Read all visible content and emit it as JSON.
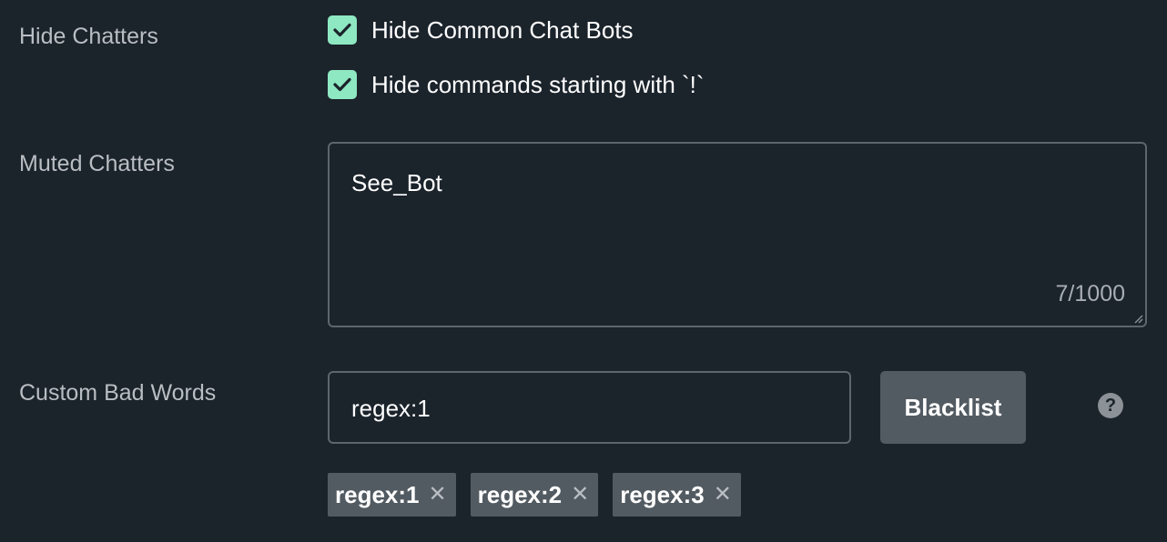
{
  "hide_chatters": {
    "label": "Hide Chatters",
    "options": [
      {
        "label": "Hide Common Chat Bots",
        "checked": true
      },
      {
        "label": "Hide commands starting with `!`",
        "checked": true
      }
    ]
  },
  "muted_chatters": {
    "label": "Muted Chatters",
    "value": "See_Bot",
    "counter": "7/1000"
  },
  "custom_bad_words": {
    "label": "Custom Bad Words",
    "input_value": "regex:1",
    "button_label": "Blacklist",
    "help_icon": "?",
    "tags": [
      "regex:1",
      "regex:2",
      "regex:3"
    ],
    "remove_icon": "✕"
  },
  "colors": {
    "background": "#1b232b",
    "checkbox": "#8ee8c1",
    "button": "#535b62",
    "label": "#b9bec3"
  }
}
